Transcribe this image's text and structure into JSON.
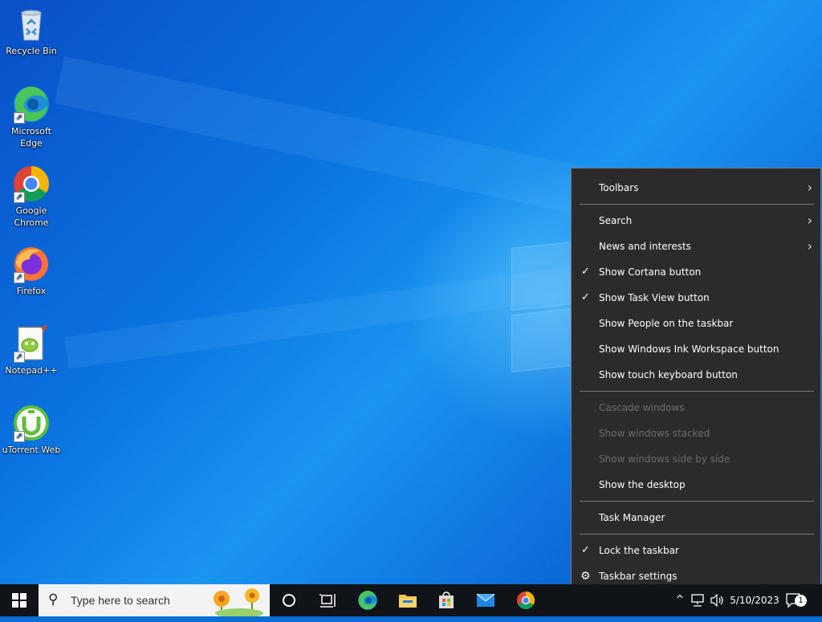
{
  "desktop": {
    "icons": [
      {
        "label": "Recycle Bin",
        "icon": "recycle-bin-icon"
      },
      {
        "label": "Microsoft Edge",
        "icon": "edge-icon"
      },
      {
        "label": "Google Chrome",
        "icon": "chrome-icon"
      },
      {
        "label": "Firefox",
        "icon": "firefox-icon"
      },
      {
        "label": "Notepad++",
        "icon": "notepadpp-icon"
      },
      {
        "label": "uTorrent Web",
        "icon": "utorrent-icon"
      }
    ]
  },
  "context_menu": {
    "items": [
      {
        "label": "Toolbars",
        "checked": false,
        "submenu": true,
        "disabled": false
      },
      {
        "label": "Search",
        "checked": false,
        "submenu": true,
        "disabled": false
      },
      {
        "label": "News and interests",
        "checked": false,
        "submenu": true,
        "disabled": false
      },
      {
        "label": "Show Cortana button",
        "checked": true,
        "submenu": false,
        "disabled": false
      },
      {
        "label": "Show Task View button",
        "checked": true,
        "submenu": false,
        "disabled": false
      },
      {
        "label": "Show People on the taskbar",
        "checked": false,
        "submenu": false,
        "disabled": false
      },
      {
        "label": "Show Windows Ink Workspace button",
        "checked": false,
        "submenu": false,
        "disabled": false
      },
      {
        "label": "Show touch keyboard button",
        "checked": false,
        "submenu": false,
        "disabled": false
      },
      {
        "label": "Cascade windows",
        "checked": false,
        "submenu": false,
        "disabled": true
      },
      {
        "label": "Show windows stacked",
        "checked": false,
        "submenu": false,
        "disabled": true
      },
      {
        "label": "Show windows side by side",
        "checked": false,
        "submenu": false,
        "disabled": true
      },
      {
        "label": "Show the desktop",
        "checked": false,
        "submenu": false,
        "disabled": false
      },
      {
        "label": "Task Manager",
        "checked": false,
        "submenu": false,
        "disabled": false
      },
      {
        "label": "Lock the taskbar",
        "checked": true,
        "submenu": false,
        "disabled": false
      },
      {
        "label": "Taskbar settings",
        "checked": false,
        "submenu": false,
        "disabled": false,
        "icon": "gear-icon"
      }
    ]
  },
  "taskbar": {
    "search_placeholder": "Type here to search",
    "pinned": [
      "cortana-icon",
      "task-view-icon",
      "edge-icon",
      "file-explorer-icon",
      "store-icon",
      "mail-icon",
      "chrome-icon"
    ],
    "tray": {
      "date": "5/10/2023",
      "notification_count": "1"
    }
  },
  "colors": {
    "menu_bg": "#2b2b2b",
    "menu_disabled_text": "#6d6d6d",
    "taskbar_bg": "#101418",
    "desktop_blue": "#0a74e0"
  }
}
